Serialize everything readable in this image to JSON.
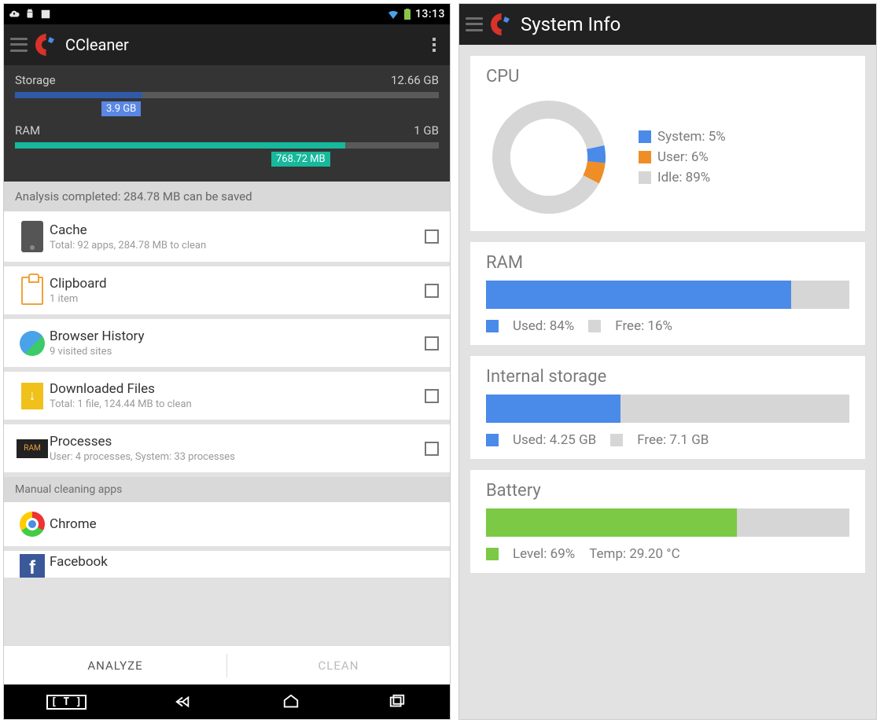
{
  "left": {
    "status_time": "13:13",
    "app_title": "CCleaner",
    "storage_label": "Storage",
    "storage_total": "12.66 GB",
    "storage_used_badge": "3.9 GB",
    "ram_label": "RAM",
    "ram_total": "1 GB",
    "ram_used_badge": "768.72 MB",
    "analysis": "Analysis completed: 284.78 MB can be saved",
    "items": [
      {
        "title": "Cache",
        "sub": "Total: 92 apps, 284.78 MB to clean"
      },
      {
        "title": "Clipboard",
        "sub": "1 item"
      },
      {
        "title": "Browser History",
        "sub": "9 visited sites"
      },
      {
        "title": "Downloaded Files",
        "sub": "Total: 1 file, 124.44 MB to clean"
      },
      {
        "title": "Processes",
        "sub": "User: 4 processes, System: 33 processes"
      }
    ],
    "section_manual": "Manual cleaning apps",
    "apps": [
      "Chrome",
      "Facebook"
    ],
    "btn_analyze": "ANALYZE",
    "btn_clean": "CLEAN"
  },
  "right": {
    "app_title": "System Info",
    "cpu_title": "CPU",
    "cpu_legend": [
      {
        "label": "System: 5%",
        "color": "#4a8ae8"
      },
      {
        "label": "User: 6%",
        "color": "#ef8e26"
      },
      {
        "label": "Idle: 89%",
        "color": "#d6d6d6"
      }
    ],
    "ram_title": "RAM",
    "ram_used": "Used: 84%",
    "ram_free": "Free: 16%",
    "stor_title": "Internal storage",
    "stor_used": "Used: 4.25 GB",
    "stor_free": "Free: 7.1 GB",
    "bat_title": "Battery",
    "bat_level": "Level: 69%",
    "bat_temp": "Temp: 29.20 °C"
  },
  "colors": {
    "blue": "#4a8ae8",
    "orange": "#ef8e26",
    "grey": "#d6d6d6",
    "green": "#7bc945"
  },
  "chart_data": [
    {
      "type": "pie",
      "title": "CPU",
      "series": [
        {
          "name": "System",
          "value": 5
        },
        {
          "name": "User",
          "value": 6
        },
        {
          "name": "Idle",
          "value": 89
        }
      ]
    },
    {
      "type": "bar",
      "title": "RAM",
      "categories": [
        "Used",
        "Free"
      ],
      "values": [
        84,
        16
      ],
      "unit": "%"
    },
    {
      "type": "bar",
      "title": "Internal storage",
      "categories": [
        "Used",
        "Free"
      ],
      "values": [
        4.25,
        7.1
      ],
      "unit": "GB"
    },
    {
      "type": "bar",
      "title": "Battery",
      "categories": [
        "Level"
      ],
      "values": [
        69
      ],
      "unit": "%",
      "temp_c": 29.2
    }
  ],
  "left_meters": {
    "storage_used_pct": 31,
    "ram_used_pct": 78
  }
}
